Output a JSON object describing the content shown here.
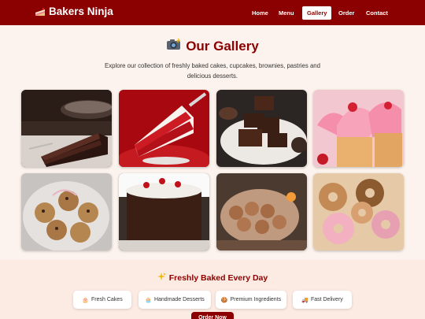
{
  "brand": {
    "name": "Bakers Ninja",
    "icon": "cake-slice-icon"
  },
  "nav": {
    "items": [
      {
        "label": "Home"
      },
      {
        "label": "Menu"
      },
      {
        "label": "Gallery",
        "active": true
      },
      {
        "label": "Order"
      },
      {
        "label": "Contact"
      }
    ]
  },
  "gallery": {
    "icon": "camera-flash-icon",
    "title": "Our Gallery",
    "subtitle": "Explore our collection of freshly baked cakes, cupcakes, brownies, pastries and delicious desserts.",
    "photos": [
      {
        "name": "chocolate-cake-slice-photo"
      },
      {
        "name": "red-velvet-cake-photo"
      },
      {
        "name": "brownies-photo"
      },
      {
        "name": "strawberry-cupcakes-photo"
      },
      {
        "name": "chocolate-chip-cookies-photo"
      },
      {
        "name": "black-forest-cake-photo"
      },
      {
        "name": "cinnamon-rolls-photo"
      },
      {
        "name": "donuts-photo"
      }
    ]
  },
  "baked": {
    "icon": "sparkles-icon",
    "title": "Freshly Baked Every Day",
    "features": [
      {
        "icon": "cake-icon",
        "label": "Fresh Cakes"
      },
      {
        "icon": "cupcake-icon",
        "label": "Handmade Desserts"
      },
      {
        "icon": "cookie-icon",
        "label": "Premium Ingredients"
      },
      {
        "icon": "truck-icon",
        "label": "Fast Delivery"
      }
    ],
    "cta_label": "Order Now"
  },
  "colors": {
    "accent": "#8b0000",
    "background": "#fdf3ee"
  }
}
